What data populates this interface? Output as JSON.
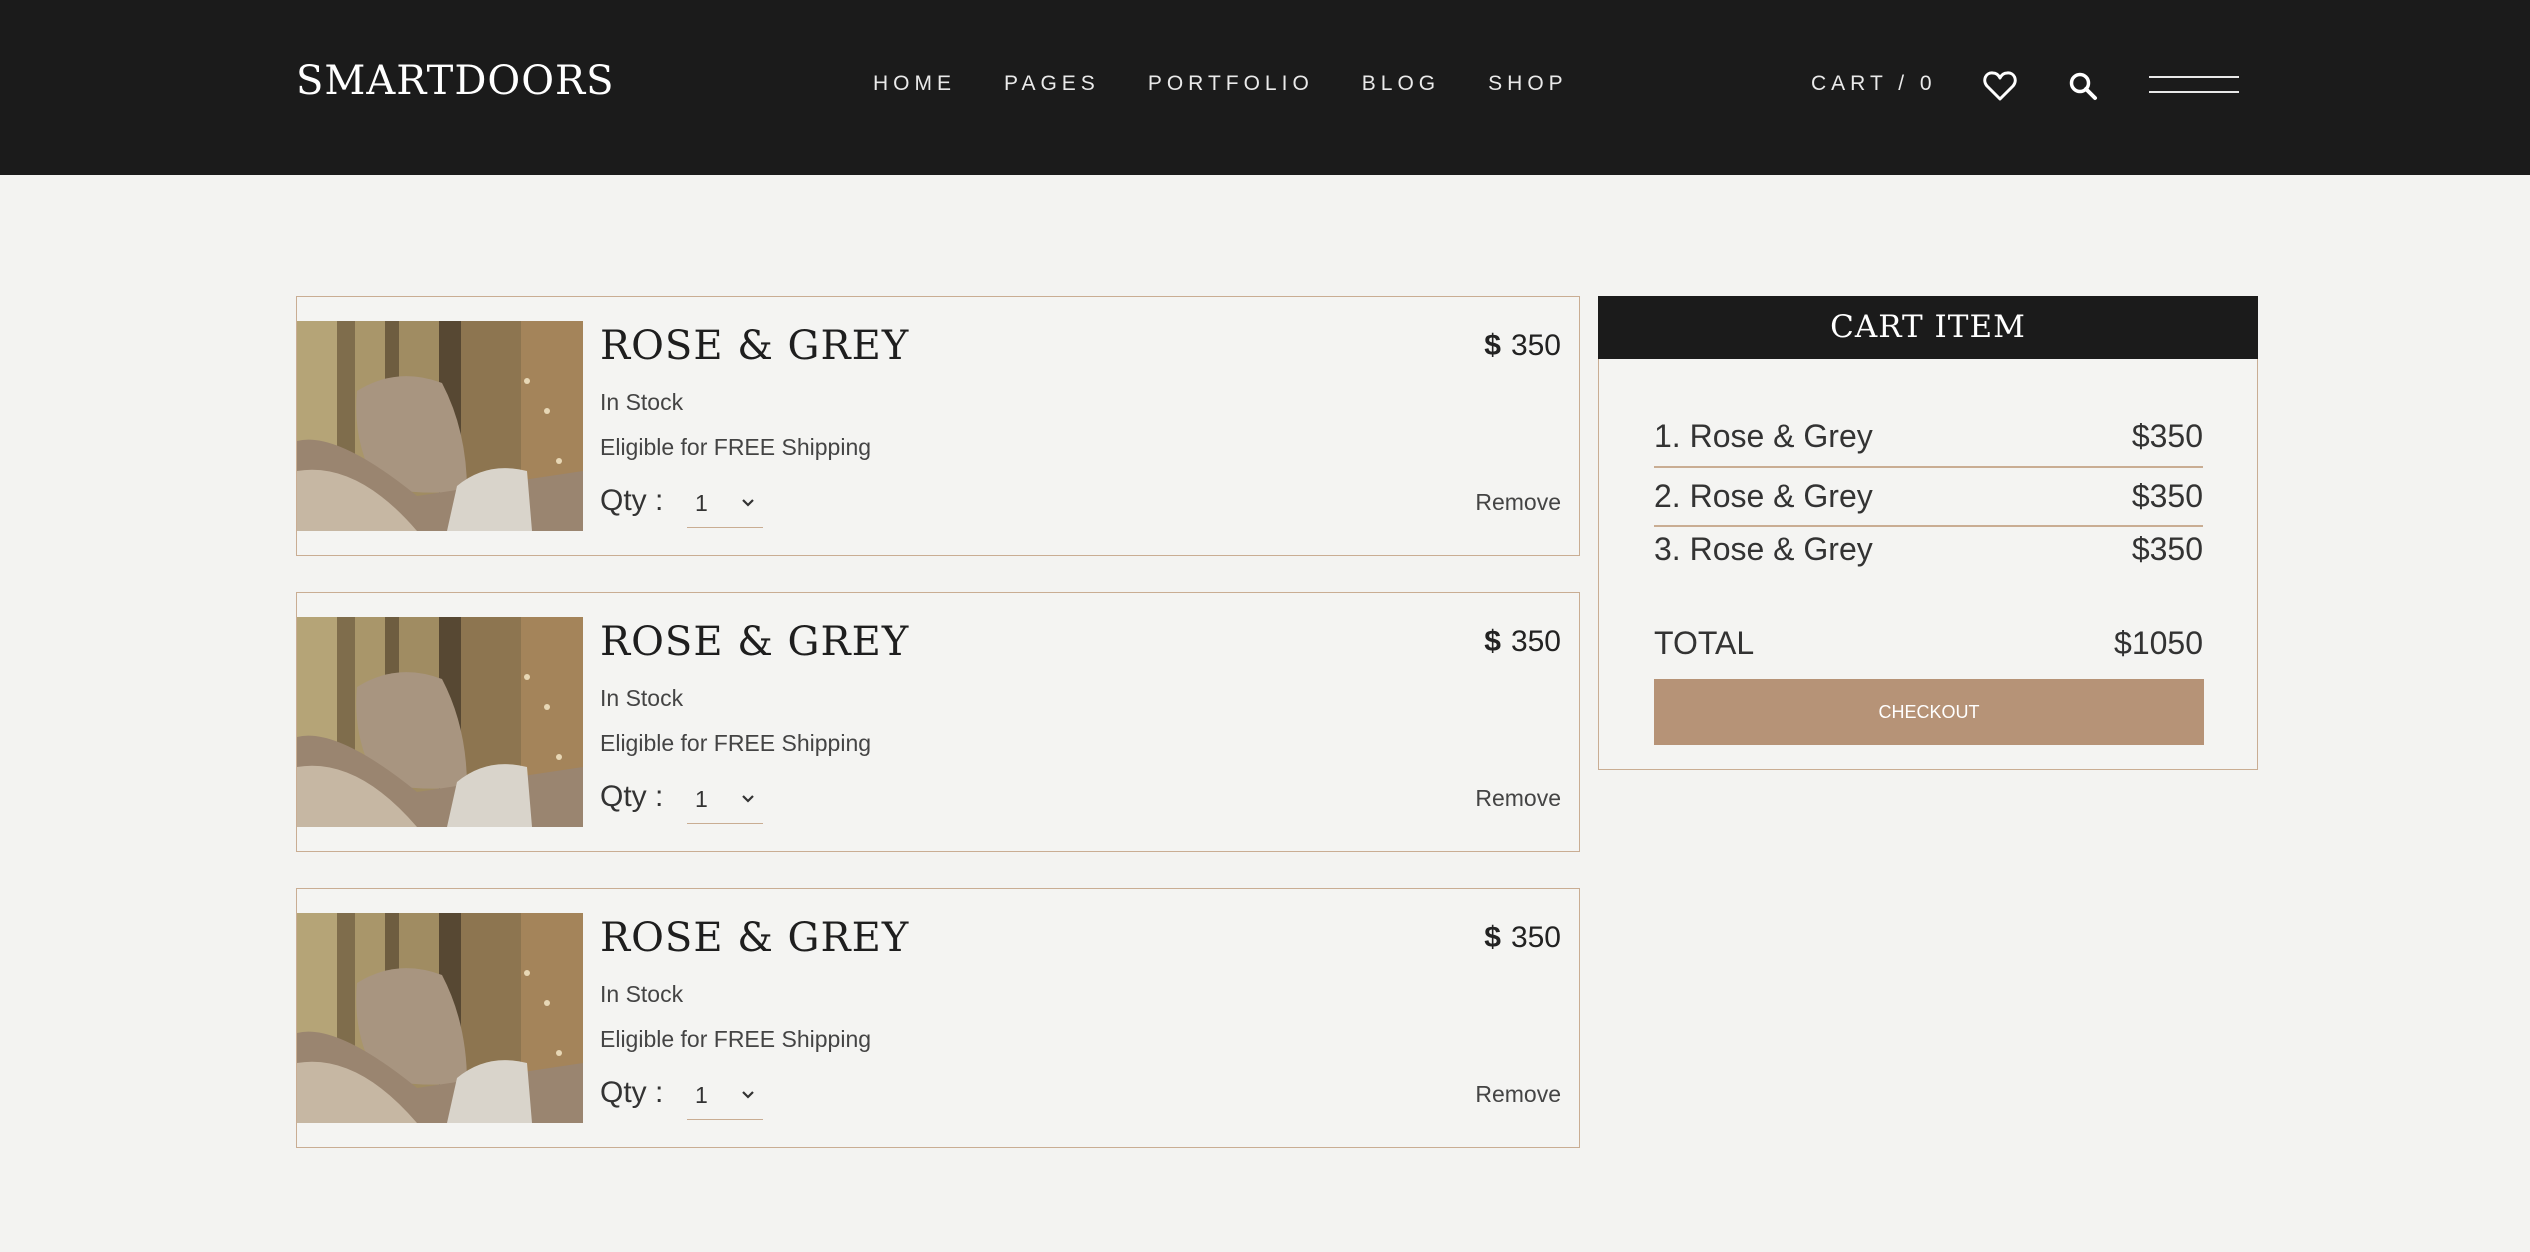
{
  "header": {
    "logo": "SMARTDOORS",
    "nav": [
      "HOME",
      "PAGES",
      "PORTFOLIO",
      "BLOG",
      "SHOP"
    ],
    "cart": "CART / 0",
    "icons": [
      "heart-icon",
      "search-icon",
      "menu-icon"
    ]
  },
  "products": [
    {
      "title": "ROSE & GREY",
      "currency": "$",
      "price": "350",
      "stock": "In Stock",
      "shipping": "Eligible for FREE Shipping",
      "qty_label": "Qty :",
      "qty": "1",
      "remove": "Remove"
    },
    {
      "title": "ROSE & GREY",
      "currency": "$",
      "price": "350",
      "stock": "In Stock",
      "shipping": "Eligible for FREE Shipping",
      "qty_label": "Qty :",
      "qty": "1",
      "remove": "Remove"
    },
    {
      "title": "ROSE & GREY",
      "currency": "$",
      "price": "350",
      "stock": "In Stock",
      "shipping": "Eligible for FREE Shipping",
      "qty_label": "Qty :",
      "qty": "1",
      "remove": "Remove"
    }
  ],
  "summary": {
    "title": "CART ITEM",
    "items": [
      {
        "name": "1. Rose & Grey",
        "price": "$350"
      },
      {
        "name": "2. Rose & Grey",
        "price": "$350"
      },
      {
        "name": "3. Rose & Grey",
        "price": "$350"
      }
    ],
    "total_label": "TOTAL",
    "total_value": "$1050",
    "checkout": "CHECKOUT"
  },
  "colors": {
    "header_bg": "#1b1b1b",
    "accent": "#b69377",
    "border": "#c9ad93",
    "page_bg": "#f3f3f1"
  }
}
